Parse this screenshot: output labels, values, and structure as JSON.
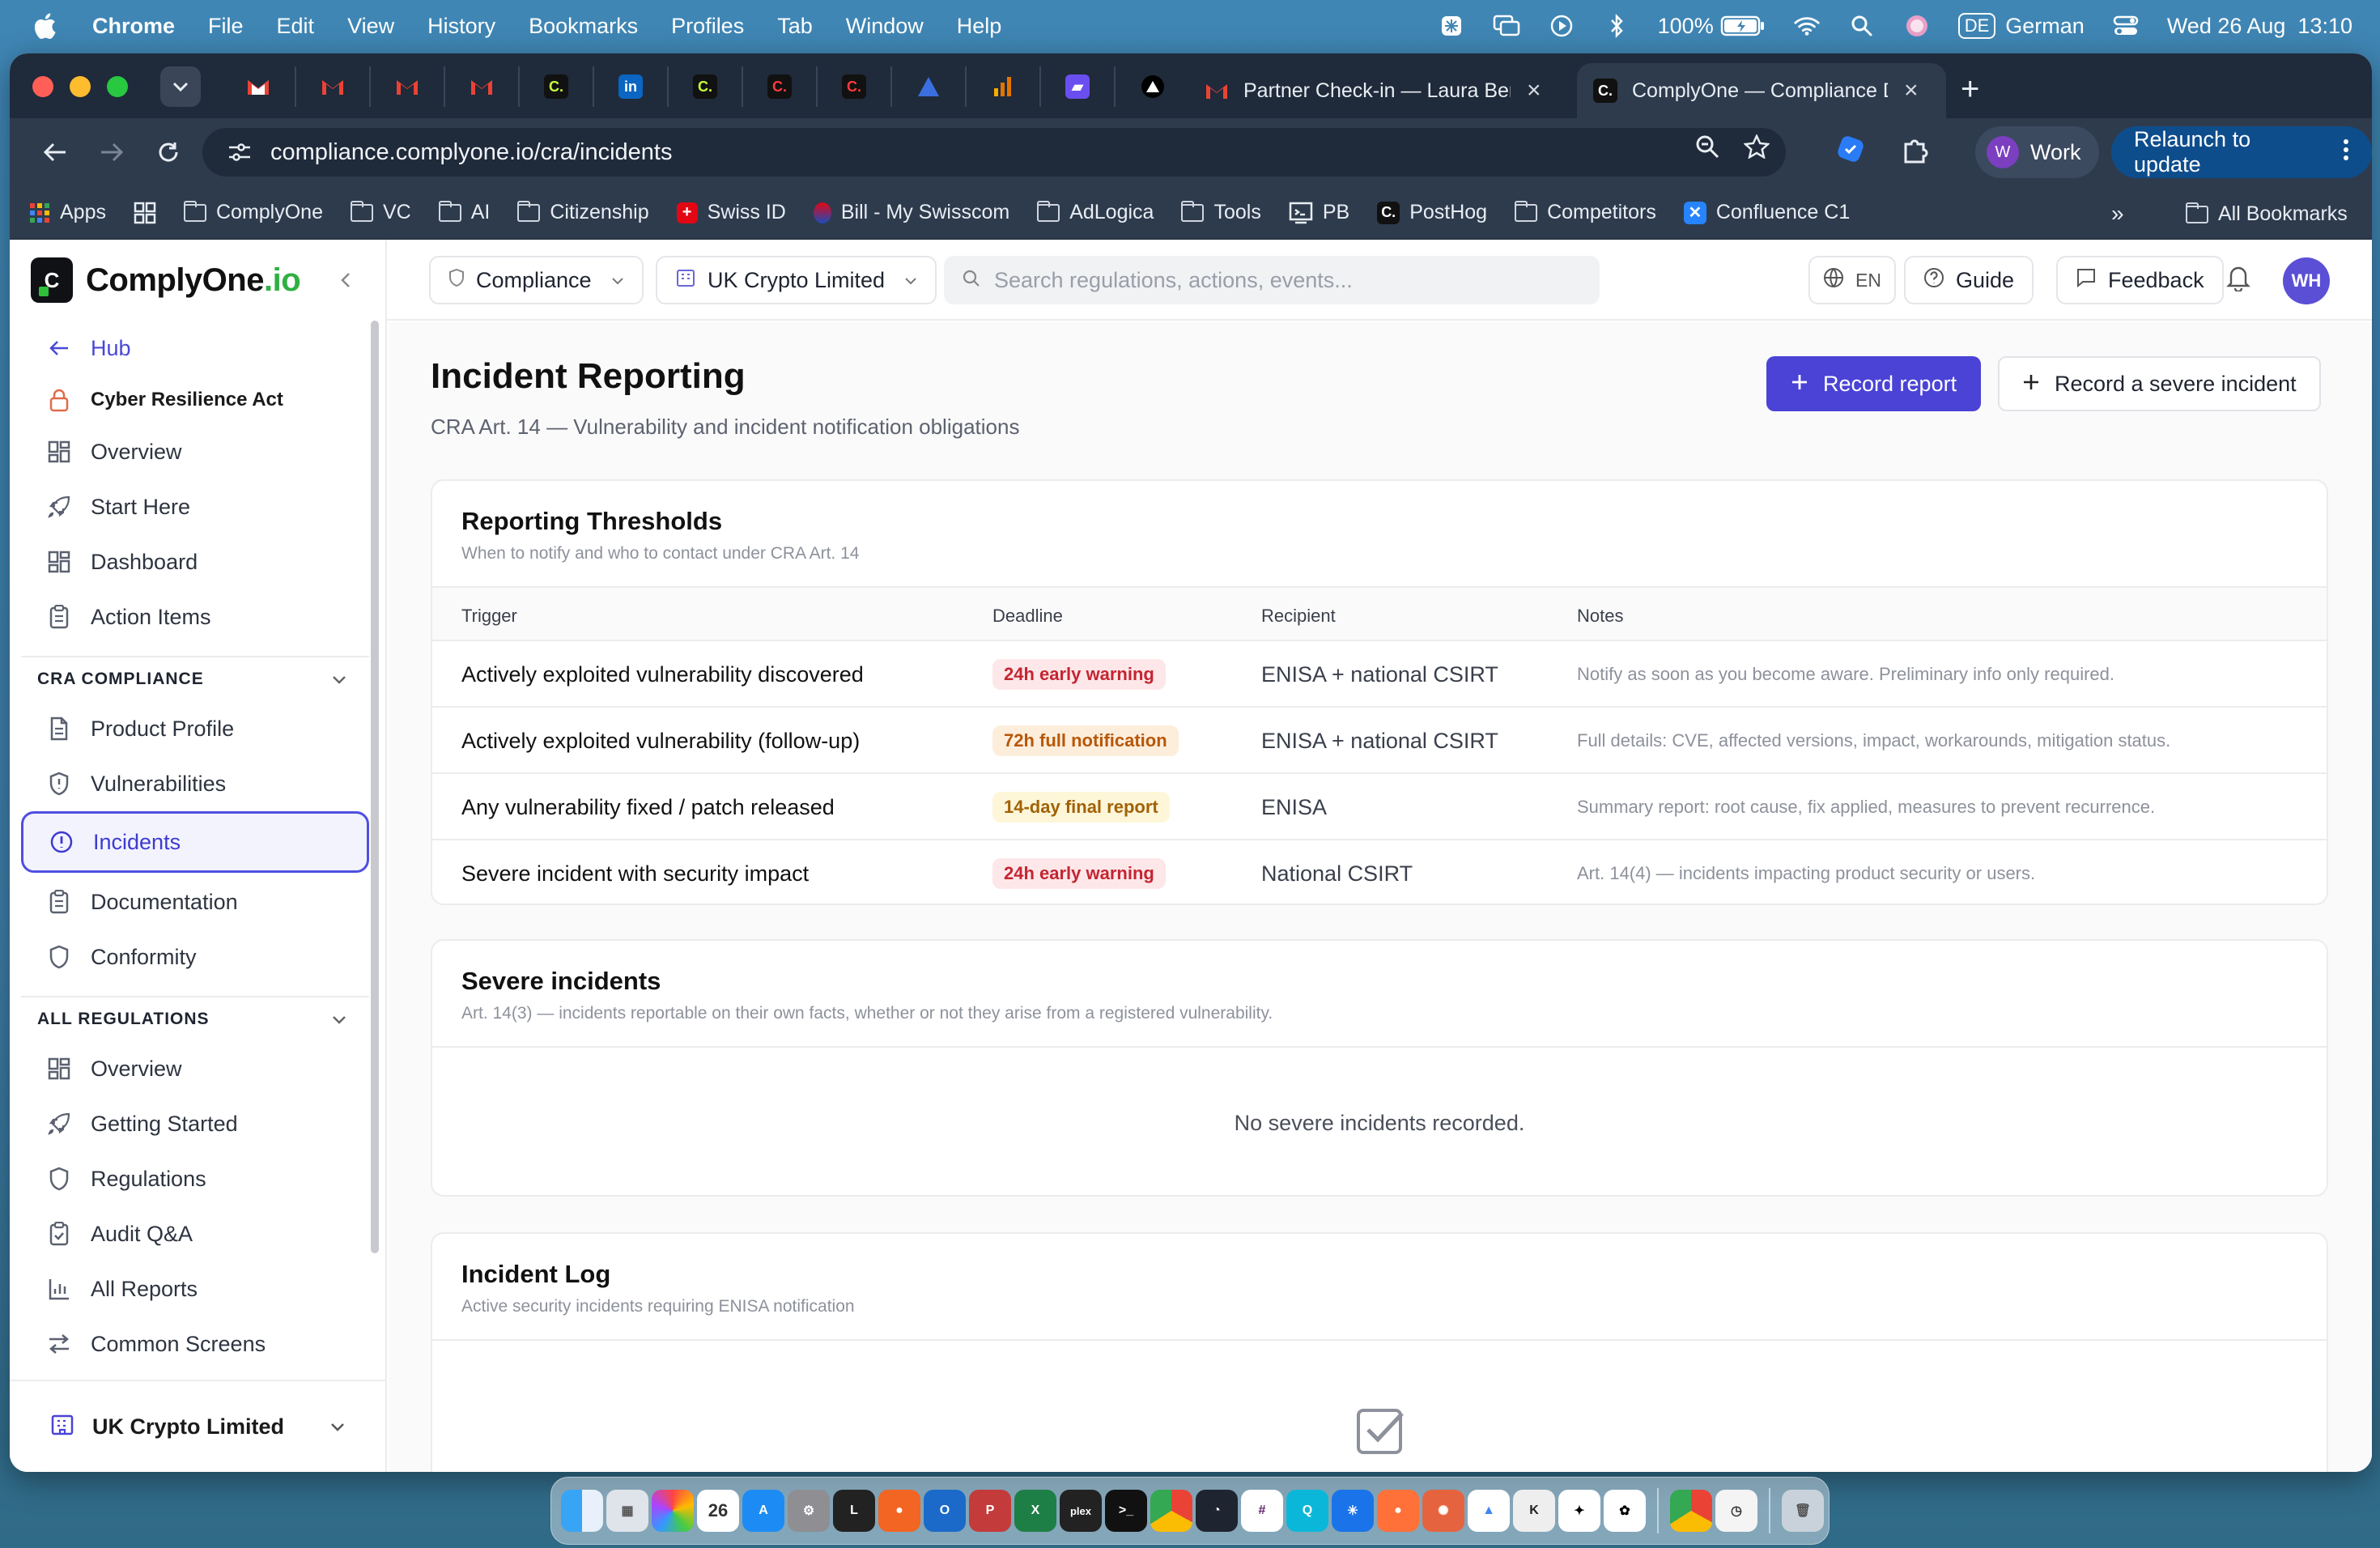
{
  "menubar": {
    "app_name": "Chrome",
    "items": [
      "File",
      "Edit",
      "View",
      "History",
      "Bookmarks",
      "Profiles",
      "Tab",
      "Window",
      "Help"
    ],
    "battery": "100%",
    "input_lang_badge": "DE",
    "input_lang": "German",
    "datetime": "Wed 26 Aug  13:10"
  },
  "browser": {
    "tabs": [
      {
        "title": "Partner Check-in — Laura Ber",
        "favicon": "gmail-icon"
      },
      {
        "title": "ComplyOne — Compliance Da",
        "favicon": "complyone-icon",
        "active": true
      }
    ],
    "url": "compliance.complyone.io/cra/incidents",
    "profile_initial": "W",
    "profile_name": "Work",
    "relaunch_label": "Relaunch to update",
    "bookmarks": [
      {
        "label": "Apps",
        "icon": "apps-grid-icon"
      },
      {
        "label": "",
        "icon": "tab-groups-icon"
      },
      {
        "label": "ComplyOne",
        "icon": "folder-icon"
      },
      {
        "label": "VC",
        "icon": "folder-icon"
      },
      {
        "label": "AI",
        "icon": "folder-icon"
      },
      {
        "label": "Citizenship",
        "icon": "folder-icon"
      },
      {
        "label": "Swiss ID",
        "icon": "swiss-id-icon"
      },
      {
        "label": "Bill - My Swisscom",
        "icon": "swisscom-icon"
      },
      {
        "label": "AdLogica",
        "icon": "folder-icon"
      },
      {
        "label": "Tools",
        "icon": "folder-icon"
      },
      {
        "label": "PB",
        "icon": "pb-icon"
      },
      {
        "label": "PostHog",
        "icon": "posthog-icon"
      },
      {
        "label": "Competitors",
        "icon": "folder-icon"
      },
      {
        "label": "Confluence C1",
        "icon": "confluence-icon"
      }
    ],
    "all_bookmarks": "All Bookmarks"
  },
  "sidebar": {
    "brand": {
      "name": "ComplyOne",
      "suffix": ".io"
    },
    "hub_label": "Hub",
    "regulation_label": "Cyber Resilience Act",
    "top_items": [
      {
        "label": "Overview",
        "icon": "grid-icon"
      },
      {
        "label": "Start Here",
        "icon": "rocket-icon"
      },
      {
        "label": "Dashboard",
        "icon": "dashboard-icon"
      },
      {
        "label": "Action Items",
        "icon": "clipboard-icon"
      }
    ],
    "cra_section": {
      "heading": "CRA COMPLIANCE",
      "items": [
        {
          "label": "Product Profile",
          "icon": "document-icon"
        },
        {
          "label": "Vulnerabilities",
          "icon": "shield-icon"
        },
        {
          "label": "Incidents",
          "icon": "alert-circle-icon",
          "active": true
        },
        {
          "label": "Documentation",
          "icon": "clipboard-icon"
        },
        {
          "label": "Conformity",
          "icon": "shield-check-icon"
        }
      ]
    },
    "all_regs_section": {
      "heading": "ALL REGULATIONS",
      "items": [
        {
          "label": "Overview",
          "icon": "grid-icon"
        },
        {
          "label": "Getting Started",
          "icon": "rocket-icon"
        },
        {
          "label": "Regulations",
          "icon": "shield-icon"
        },
        {
          "label": "Audit Q&A",
          "icon": "clipboard-check-icon"
        },
        {
          "label": "All Reports",
          "icon": "bar-chart-icon"
        },
        {
          "label": "Common Screens",
          "icon": "arrows-icon"
        }
      ]
    },
    "org_switch": "UK Crypto Limited"
  },
  "header": {
    "scope_select": "Compliance",
    "org_select": "UK Crypto Limited",
    "search_placeholder": "Search regulations, actions, events...",
    "lang_button": "EN",
    "guide_button": "Guide",
    "feedback_button": "Feedback",
    "user_initials": "WH"
  },
  "page": {
    "title": "Incident Reporting",
    "subtitle": "CRA Art. 14 — Vulnerability and incident notification obligations",
    "primary_action": "Record report",
    "secondary_action": "Record a severe incident"
  },
  "thresholds": {
    "title": "Reporting Thresholds",
    "subtitle": "When to notify and who to contact under CRA Art. 14",
    "columns": [
      "Trigger",
      "Deadline",
      "Recipient",
      "Notes"
    ],
    "rows": [
      {
        "trigger": "Actively exploited vulnerability discovered",
        "deadline": "24h early warning",
        "severity": "red",
        "recipient": "ENISA + national CSIRT",
        "notes": "Notify as soon as you become aware. Preliminary info only required."
      },
      {
        "trigger": "Actively exploited vulnerability (follow-up)",
        "deadline": "72h full notification",
        "severity": "orange",
        "recipient": "ENISA + national CSIRT",
        "notes": "Full details: CVE, affected versions, impact, workarounds, mitigation status."
      },
      {
        "trigger": "Any vulnerability fixed / patch released",
        "deadline": "14-day final report",
        "severity": "yellow",
        "recipient": "ENISA",
        "notes": "Summary report: root cause, fix applied, measures to prevent recurrence."
      },
      {
        "trigger": "Severe incident with security impact",
        "deadline": "24h early warning",
        "severity": "red",
        "recipient": "National CSIRT",
        "notes": "Art. 14(4) — incidents impacting product security or users."
      }
    ],
    "badge_colors": {
      "red": "#c42531",
      "orange": "#b85708",
      "yellow": "#a16207"
    }
  },
  "severe": {
    "title": "Severe incidents",
    "subtitle": "Art. 14(3) — incidents reportable on their own facts, whether or not they arise from a registered vulnerability.",
    "empty": "No severe incidents recorded."
  },
  "log": {
    "title": "Incident Log",
    "subtitle": "Active security incidents requiring ENISA notification"
  },
  "colors": {
    "accent": "#4a43d6",
    "brand_green": "#2fb042"
  }
}
